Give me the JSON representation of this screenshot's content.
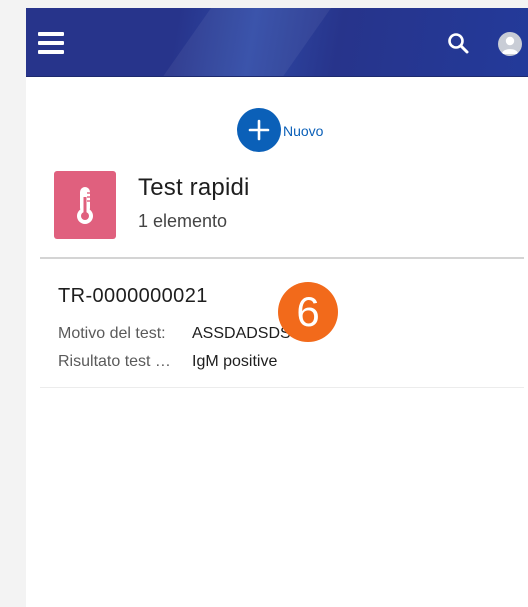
{
  "header": {
    "menu_icon": "hamburger-menu-icon",
    "search_icon": "search-icon",
    "avatar_icon": "user-avatar-icon",
    "background_color": "#27348b"
  },
  "actions": {
    "new_label": "Nuovo",
    "new_icon": "plus-icon",
    "accent_color": "#0b60b8"
  },
  "list": {
    "icon": "thermometer-icon",
    "icon_color": "#e0607e",
    "title": "Test rapidi",
    "count_label": "1 elemento"
  },
  "records": [
    {
      "id": "TR-0000000021",
      "fields": [
        {
          "label": "Motivo del test:",
          "value": "ASSDADSDS"
        },
        {
          "label": "Risultato test …",
          "value": "IgM positive"
        }
      ]
    }
  ],
  "annotation": {
    "step_number": "6",
    "color": "#f26a1b"
  }
}
